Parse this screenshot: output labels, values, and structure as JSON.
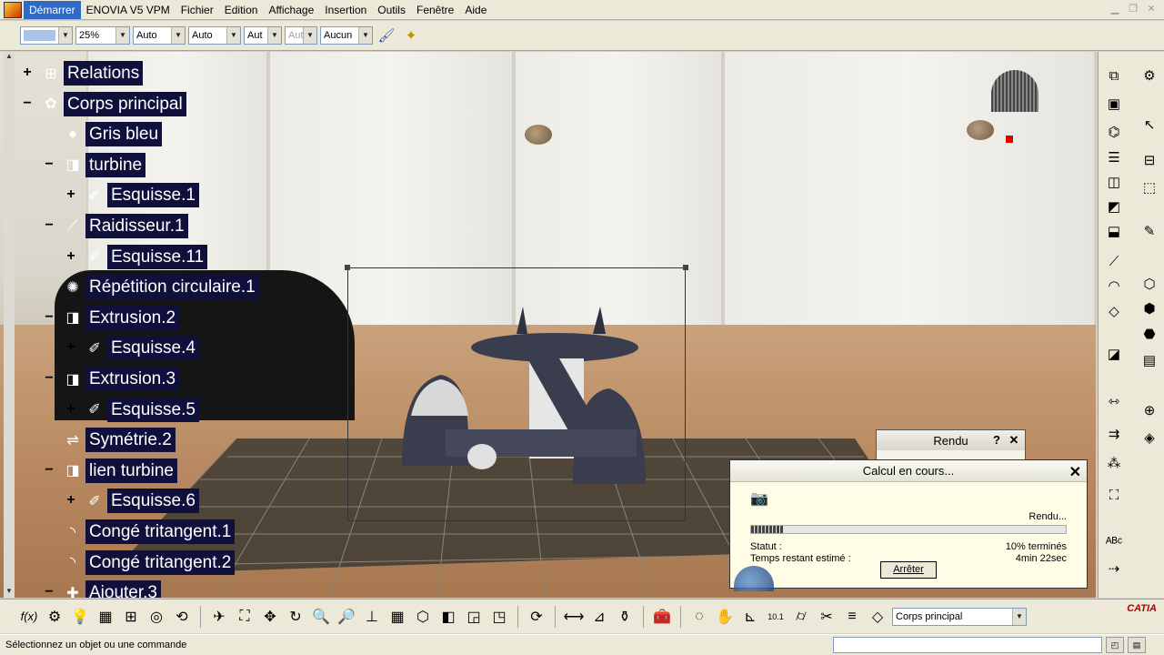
{
  "menubar": {
    "items": [
      "Démarrer",
      "ENOVIA V5 VPM",
      "Fichier",
      "Edition",
      "Affichage",
      "Insertion",
      "Outils",
      "Fenêtre",
      "Aide"
    ]
  },
  "toolbar_top": {
    "color_value": "",
    "opacity_value": "25%",
    "linetype_value": "Auto",
    "thickness_value": "Auto",
    "layer_value": "Aut",
    "layer2_value": "Aut",
    "filter_value": "Aucun",
    "icons": [
      "paint-brush-icon",
      "apply-material-icon"
    ]
  },
  "tree": {
    "nodes": [
      {
        "label": "Relations",
        "icon": "relations-icon",
        "expander": "+"
      },
      {
        "label": "Corps principal",
        "icon": "part-body-icon",
        "expander": "−"
      },
      {
        "label": "Gris bleu",
        "icon": "material-sphere-icon",
        "expander": ""
      },
      {
        "label": "turbine",
        "icon": "pad-icon",
        "expander": "−"
      },
      {
        "label": "Esquisse.1",
        "icon": "sketch-icon",
        "expander": "+"
      },
      {
        "label": "Raidisseur.1",
        "icon": "stiffener-icon",
        "expander": "−"
      },
      {
        "label": "Esquisse.11",
        "icon": "sketch-icon",
        "expander": "+"
      },
      {
        "label": "Répétition circulaire.1",
        "icon": "circular-pattern-icon",
        "expander": ""
      },
      {
        "label": "Extrusion.2",
        "icon": "pad-icon",
        "expander": "−"
      },
      {
        "label": "Esquisse.4",
        "icon": "sketch-icon",
        "expander": "+"
      },
      {
        "label": "Extrusion.3",
        "icon": "pad-icon",
        "expander": "−"
      },
      {
        "label": "Esquisse.5",
        "icon": "sketch-icon",
        "expander": "+"
      },
      {
        "label": "Symétrie.2",
        "icon": "mirror-icon",
        "expander": ""
      },
      {
        "label": "lien turbine",
        "icon": "pad-icon",
        "expander": "−"
      },
      {
        "label": "Esquisse.6",
        "icon": "sketch-icon",
        "expander": "+"
      },
      {
        "label": "Congé tritangent.1",
        "icon": "fillet-icon",
        "expander": ""
      },
      {
        "label": "Congé tritangent.2",
        "icon": "fillet-icon",
        "expander": ""
      },
      {
        "label": "Ajouter.3",
        "icon": "add-icon",
        "expander": "−"
      }
    ]
  },
  "rendu_dialog": {
    "title": "Rendu",
    "help": "?",
    "close": "✕"
  },
  "progress_dialog": {
    "title": "Calcul en cours...",
    "close": "✕",
    "rendering_label": "Rendu...",
    "progress_fraction": 0.1,
    "status_label": "Statut :",
    "status_value": "10% terminés",
    "time_label": "Temps restant estimé :",
    "time_value": "4min 22sec",
    "stop_button": "Arrêter"
  },
  "toolbar_bottom": {
    "body_select_value": "Corps principal",
    "brand": "CATIA"
  },
  "statusbar": {
    "message": "Sélectionnez un objet ou une commande"
  }
}
